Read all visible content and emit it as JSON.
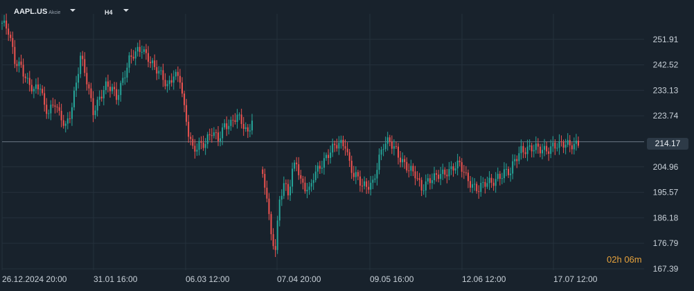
{
  "header": {
    "symbol": "AAPL.US",
    "asset_type": "Akcie",
    "timeframe": "H4"
  },
  "countdown": {
    "hours": "02",
    "h_unit": "h",
    "minutes": "06",
    "m_unit": "m"
  },
  "colors": {
    "background": "#18222c",
    "up": "#26a69a",
    "down": "#ef5350",
    "grid": "#25313c",
    "price_line": "#6b7784"
  },
  "chart_data": {
    "type": "candlestick",
    "title": "",
    "ylim": [
      167.39,
      261.3
    ],
    "y_ticks": [
      "251.91",
      "242.52",
      "233.13",
      "223.74",
      "214.17",
      "204.96",
      "195.57",
      "186.18",
      "176.79",
      "167.39"
    ],
    "x_ticks": [
      {
        "date": "26.12.2024",
        "time": "20:00"
      },
      {
        "date": "31.01",
        "time": "16:00"
      },
      {
        "date": "06.03",
        "time": "12:00"
      },
      {
        "date": "07.04",
        "time": "20:00"
      },
      {
        "date": "09.05",
        "time": "16:00"
      },
      {
        "date": "12.06",
        "time": "12:00"
      },
      {
        "date": "17.07",
        "time": "12:00"
      }
    ],
    "last_price": "214.17",
    "close_path": [
      [
        0,
        258
      ],
      [
        3,
        254
      ],
      [
        6,
        244
      ],
      [
        9,
        243
      ],
      [
        12,
        236
      ],
      [
        15,
        232
      ],
      [
        18,
        235
      ],
      [
        20,
        228
      ],
      [
        22,
        226
      ],
      [
        25,
        228
      ],
      [
        27,
        223
      ],
      [
        30,
        220
      ],
      [
        32,
        225
      ],
      [
        35,
        236
      ],
      [
        37,
        245
      ],
      [
        40,
        236
      ],
      [
        43,
        226
      ],
      [
        46,
        231
      ],
      [
        49,
        234
      ],
      [
        52,
        233
      ],
      [
        54,
        231
      ],
      [
        57,
        238
      ],
      [
        60,
        244
      ],
      [
        63,
        246
      ],
      [
        66,
        249
      ],
      [
        69,
        246
      ],
      [
        72,
        241
      ],
      [
        75,
        238
      ],
      [
        78,
        235
      ],
      [
        81,
        240
      ],
      [
        84,
        237
      ],
      [
        86,
        225
      ],
      [
        88,
        217
      ],
      [
        90,
        212
      ],
      [
        93,
        214
      ],
      [
        96,
        213
      ],
      [
        99,
        217
      ],
      [
        102,
        216
      ],
      [
        105,
        221
      ],
      [
        108,
        220
      ],
      [
        111,
        223
      ],
      [
        114,
        221
      ],
      [
        116,
        218
      ],
      [
        118,
        223
      ],
      [
        123,
        200
      ],
      [
        125,
        195
      ],
      [
        127,
        180
      ],
      [
        129,
        176
      ],
      [
        131,
        192
      ],
      [
        133,
        198
      ],
      [
        135,
        194
      ],
      [
        137,
        204
      ],
      [
        139,
        208
      ],
      [
        141,
        200
      ],
      [
        143,
        197
      ],
      [
        145,
        195
      ],
      [
        147,
        201
      ],
      [
        150,
        206
      ],
      [
        153,
        209
      ],
      [
        156,
        211
      ],
      [
        159,
        213
      ],
      [
        162,
        214
      ],
      [
        164,
        207
      ],
      [
        166,
        202
      ],
      [
        168,
        200
      ],
      [
        170,
        197
      ],
      [
        172,
        198
      ],
      [
        175,
        200
      ],
      [
        178,
        208
      ],
      [
        180,
        212
      ],
      [
        183,
        214
      ],
      [
        186,
        212
      ],
      [
        189,
        207
      ],
      [
        192,
        203
      ],
      [
        195,
        202
      ],
      [
        198,
        198
      ],
      [
        201,
        200
      ],
      [
        204,
        200
      ],
      [
        207,
        202
      ],
      [
        210,
        204
      ],
      [
        213,
        205
      ],
      [
        216,
        205
      ],
      [
        219,
        201
      ],
      [
        222,
        199
      ],
      [
        225,
        197
      ],
      [
        228,
        198
      ],
      [
        231,
        199
      ],
      [
        234,
        202
      ],
      [
        237,
        203
      ],
      [
        240,
        202
      ],
      [
        242,
        207
      ],
      [
        245,
        212
      ],
      [
        248,
        212
      ],
      [
        251,
        211
      ],
      [
        254,
        211
      ],
      [
        257,
        212
      ],
      [
        260,
        213
      ],
      [
        263,
        212
      ],
      [
        266,
        213
      ],
      [
        269,
        214
      ],
      [
        272,
        214
      ]
    ]
  }
}
